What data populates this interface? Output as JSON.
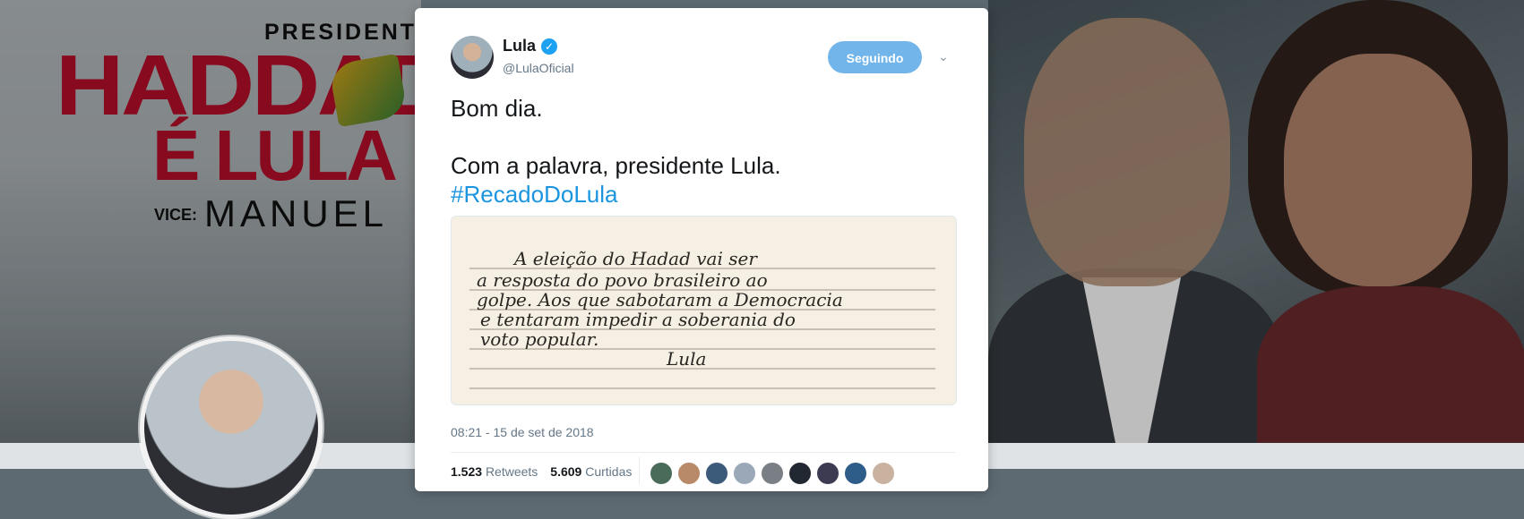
{
  "banner": {
    "president": "PRESIDENT",
    "haddad": "HADDAD",
    "e_lula": "É LULA",
    "vice_label": "VICE:",
    "manuela": "MANUEL"
  },
  "tweet": {
    "display_name": "Lula",
    "handle": "@LulaOficial",
    "follow_label": "Seguindo",
    "text_line1": "Bom dia.",
    "text_line2": "Com a palavra, presidente Lula.",
    "hashtag": "#RecadoDoLula",
    "timestamp": "08:21 - 15 de set de 2018",
    "retweets_count": "1.523",
    "retweets_label": "Retweets",
    "likes_count": "5.609",
    "likes_label": "Curtidas",
    "image_handwriting": [
      "A eleição do Hadad vai ser",
      "a resposta do povo brasileiro ao",
      "golpe. Aos que sabotaram a Democracia",
      "e tentaram impedir a soberania do",
      "voto popular.",
      "Lula"
    ]
  },
  "colors": {
    "accent": "#1da1f2",
    "follow_button": "#71b5ea",
    "hashtag": "#1b95e0",
    "banner_red": "#c8102e"
  },
  "icons": {
    "verified": "verified-badge-icon",
    "dropdown": "chevron-down-icon"
  },
  "liker_colors": [
    "#4a6b5a",
    "#b98a6a",
    "#3c5a7a",
    "#9aa8b8",
    "#7a7f86",
    "#222831",
    "#3d3b52",
    "#2f5d8a",
    "#c9b2a0"
  ]
}
